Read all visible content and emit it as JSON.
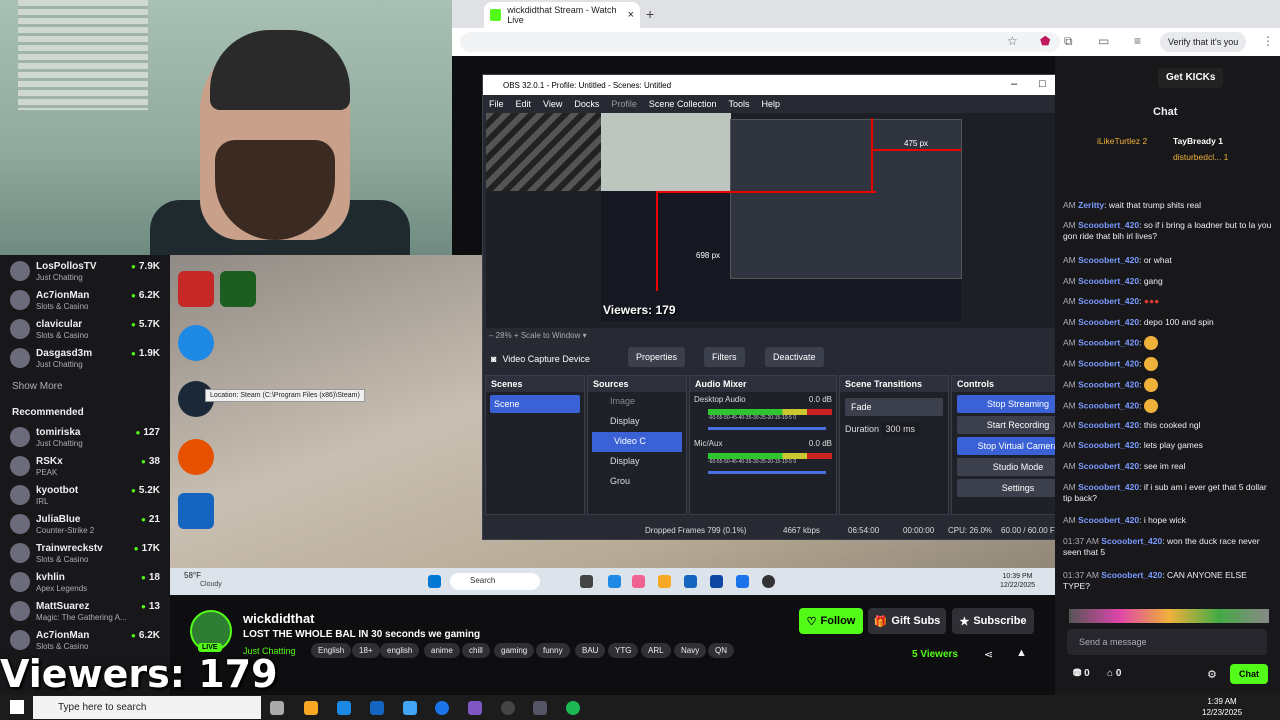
{
  "browser": {
    "tab_title": "wickdidthat Stream - Watch Live",
    "tab_close": "×",
    "new_tab": "+",
    "verify_label": "Verify that it's you",
    "menu_icon": "⋮"
  },
  "sidebar": {
    "channels": [
      {
        "name": "LosPollosTV",
        "game": "Just Chatting",
        "viewers": "7.9K"
      },
      {
        "name": "Ac7ionMan",
        "game": "Slots & Casino",
        "viewers": "6.2K"
      },
      {
        "name": "clavicular",
        "game": "Slots & Casino",
        "viewers": "5.7K"
      },
      {
        "name": "Dasgasd3m",
        "game": "Just Chatting",
        "viewers": "1.9K"
      }
    ],
    "show_more": "Show More",
    "recommended_label": "Recommended",
    "recommended": [
      {
        "name": "tomiriska",
        "game": "Just Chatting",
        "viewers": "127"
      },
      {
        "name": "RSKx",
        "game": "PEAK",
        "viewers": "38"
      },
      {
        "name": "kyootbot",
        "game": "IRL",
        "viewers": "5.2K"
      },
      {
        "name": "JuliaBlue",
        "game": "Counter-Strike 2",
        "viewers": "21"
      },
      {
        "name": "Trainwreckstv",
        "game": "Slots & Casino",
        "viewers": "17K"
      },
      {
        "name": "kvhlin",
        "game": "Apex Legends",
        "viewers": "18"
      },
      {
        "name": "MattSuarez",
        "game": "Magic: The Gathering A...",
        "viewers": "13"
      },
      {
        "name": "Ac7ionMan",
        "game": "Slots & Casino",
        "viewers": "6.2K"
      }
    ]
  },
  "overlay_viewers": "Viewers: 179",
  "vm_desktop": {
    "steam_tooltip": "Location: Steam (C:\\Program Files (x86)\\Steam)",
    "weather": "58°F",
    "weather_desc": "Cloudy",
    "search_label": "Search",
    "time": "10:39 PM",
    "date": "12/22/2025"
  },
  "obs": {
    "title": "OBS 32.0.1 - Profile: Untitled - Scenes: Untitled",
    "menu": [
      "File",
      "Edit",
      "View",
      "Docks",
      "Profile",
      "Scene Collection",
      "Tools",
      "Help"
    ],
    "preview_px_top": "475 px",
    "preview_px_left": "698 px",
    "preview_viewers": "Viewers: 179",
    "zoom": "28%",
    "scale_to_window": "Scale to Window",
    "source_name": "Video Capture Device",
    "properties": "Properties",
    "filters": "Filters",
    "deactivate": "Deactivate",
    "docks": {
      "scenes": "Scenes",
      "scene_item": "Scene",
      "sources": "Sources",
      "source_items": [
        "Image",
        "Display",
        "Video C",
        "Display",
        "Grou"
      ],
      "audio_mixer": "Audio Mixer",
      "desktop_audio": "Desktop Audio",
      "desktop_db": "0.0 dB",
      "mic": "Mic/Aux",
      "mic_db": "0.0 dB",
      "meter_scale": "-60-55-50-45-40-35-30-25-20-15-10-5 0",
      "transitions": "Scene Transitions",
      "fade": "Fade",
      "duration_label": "Duration",
      "duration_value": "300 ms",
      "controls": "Controls",
      "stop_streaming": "Stop Streaming",
      "start_recording": "Start Recording",
      "stop_virtual_camera": "Stop Virtual Camera",
      "studio_mode": "Studio Mode",
      "settings": "Settings"
    },
    "status": {
      "dropped": "Dropped Frames 799 (0.1%)",
      "bitrate": "4667 kbps",
      "time1": "06:54:00",
      "time2": "00:00:00",
      "cpu": "CPU: 26.0%",
      "fps": "60.00 / 60.00 FPS"
    }
  },
  "stream": {
    "name": "wickdidthat",
    "live": "LIVE",
    "title": "LOST THE WHOLE BAL IN 30 seconds we gaming",
    "category": "Just Chatting",
    "tags": [
      "English",
      "18+",
      "english",
      "anime",
      "chill",
      "gaming",
      "funny",
      "BAU",
      "YTG",
      "ARL",
      "Navy",
      "QN"
    ],
    "follow": "Follow",
    "gift_subs": "Gift Subs",
    "subscribe": "Subscribe",
    "viewers": "5 Viewers"
  },
  "chat": {
    "get_kicks": "Get KICKs",
    "label": "Chat",
    "top_gifters": [
      {
        "name": "iLikeTurtlez",
        "count": "2"
      },
      {
        "name": "TayBready",
        "count": "1"
      },
      {
        "name": "disturbedcl...",
        "count": "1"
      }
    ],
    "messages": [
      {
        "time": "AM",
        "user": "Zeritty",
        "text": "wait that trump shits real"
      },
      {
        "time": "AM",
        "user": "Scooobert_420",
        "text": "so if i bring a loadner but to la you gon ride that bih irl lives?"
      },
      {
        "time": "AM",
        "user": "Scooobert_420",
        "text": "or what"
      },
      {
        "time": "AM",
        "user": "Scooobert_420",
        "text": "gang"
      },
      {
        "time": "AM",
        "user": "Scooobert_420",
        "text": "●●●"
      },
      {
        "time": "AM",
        "user": "Scooobert_420",
        "text": "depo 100 and spin"
      },
      {
        "time": "AM",
        "user": "Scooobert_420",
        "text": ""
      },
      {
        "time": "AM",
        "user": "Scooobert_420",
        "text": ""
      },
      {
        "time": "AM",
        "user": "Scooobert_420",
        "text": ""
      },
      {
        "time": "AM",
        "user": "Scooobert_420",
        "text": ""
      },
      {
        "time": "AM",
        "user": "Scooobert_420",
        "text": "this cooked ngl"
      },
      {
        "time": "AM",
        "user": "Scooobert_420",
        "text": "lets play games"
      },
      {
        "time": "AM",
        "user": "Scooobert_420",
        "text": "see im real"
      },
      {
        "time": "AM",
        "user": "Scooobert_420",
        "text": "if i sub am i ever get that 5 dollar tip back?"
      },
      {
        "time": "AM",
        "user": "Scooobert_420",
        "text": "i hope wick"
      },
      {
        "time": "01:37 AM",
        "user": "Scooobert_420",
        "text": "won the duck race never seen that 5"
      },
      {
        "time": "01:37 AM",
        "user": "Scooobert_420",
        "text": "CAN ANYONE ELSE TYPE?"
      }
    ],
    "send_placeholder": "Send a message",
    "kicks_count": "0",
    "other_count": "0",
    "chat_button": "Chat"
  },
  "taskbar": {
    "search_placeholder": "Type here to search",
    "time": "1:39 AM",
    "date": "12/23/2025"
  }
}
